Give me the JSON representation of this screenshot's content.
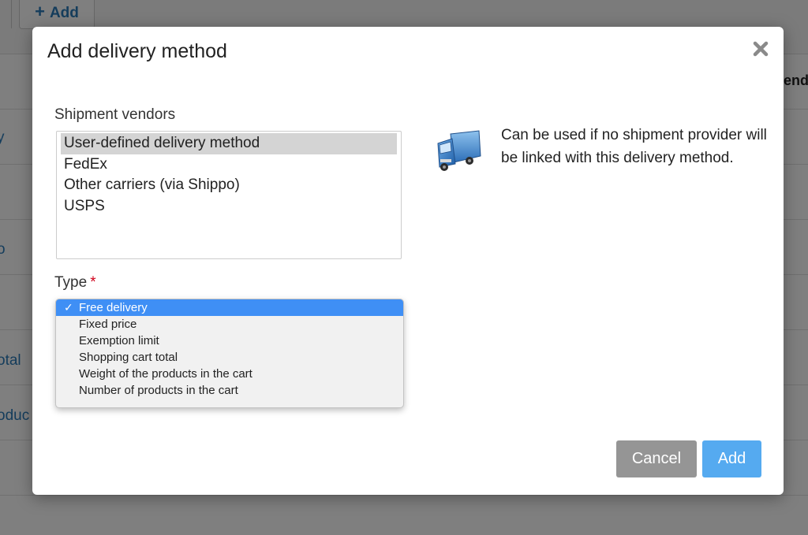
{
  "background": {
    "add_button_label": "Add",
    "links": [
      "y",
      "o",
      "otal",
      "oduc"
    ],
    "column_header": "vend"
  },
  "modal": {
    "title": "Add delivery method",
    "vendors_label": "Shipment vendors",
    "vendors": [
      {
        "label": "User-defined delivery method",
        "selected": true
      },
      {
        "label": "FedEx",
        "selected": false
      },
      {
        "label": "Other carriers (via Shippo)",
        "selected": false
      },
      {
        "label": "USPS",
        "selected": false
      }
    ],
    "info_text": "Can be used if no shipment provider will be linked with this delivery method.",
    "type_label": "Type",
    "required_marker": "*",
    "type_options": [
      {
        "label": "Free delivery",
        "selected": true
      },
      {
        "label": "Fixed price",
        "selected": false
      },
      {
        "label": "Exemption limit",
        "selected": false
      },
      {
        "label": "Shopping cart total",
        "selected": false
      },
      {
        "label": "Weight of the products in the cart",
        "selected": false
      },
      {
        "label": "Number of products in the cart",
        "selected": false
      }
    ],
    "cancel_label": "Cancel",
    "add_label": "Add"
  },
  "colors": {
    "accent_blue": "#55aaf0",
    "selected_option": "#3f8ff5",
    "cancel_gray": "#959595",
    "required_red": "#d0021b"
  },
  "icons": [
    "close-icon",
    "truck-icon",
    "check-icon",
    "plus-icon"
  ]
}
